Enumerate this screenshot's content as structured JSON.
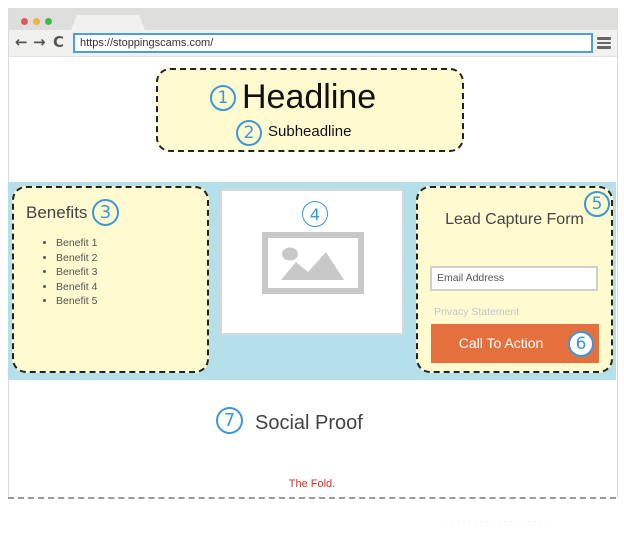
{
  "browser": {
    "url": "https://stoppingscams.com/",
    "icons": {
      "back": "←",
      "forward": "→",
      "reload": "C"
    }
  },
  "header": {
    "headline": "Headline",
    "subheadline": "Subheadline",
    "headline_number": "1",
    "subheadline_number": "2"
  },
  "benefits": {
    "title": "Benefits",
    "number": "3",
    "items": [
      "Benefit 1",
      "Benefit 2",
      "Benefit 3",
      "Benefit 4",
      "Benefit 5"
    ]
  },
  "image": {
    "number": "4"
  },
  "form": {
    "title": "Lead Capture Form",
    "number": "5",
    "email_placeholder": "Email Address",
    "privacy": "Privacy Statement",
    "cta_label": "Call To Action",
    "cta_number": "6"
  },
  "social_proof": {
    "label": "Social Proof",
    "number": "7"
  },
  "fold": {
    "label": "The Fold."
  },
  "colors": {
    "highlight_yellow": "#fffad0",
    "band_blue": "#b5e0ea",
    "number_blue": "#3b97d9",
    "cta_orange": "#e4703e",
    "fold_red": "#cc3333"
  }
}
